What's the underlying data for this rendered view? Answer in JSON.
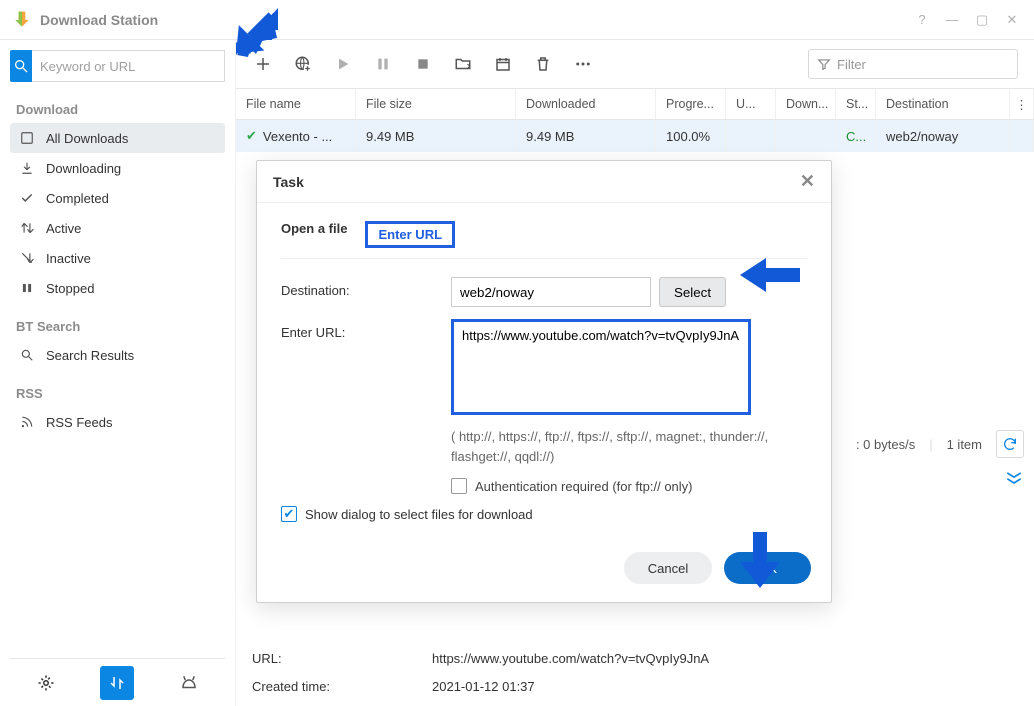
{
  "app": {
    "title": "Download Station"
  },
  "search": {
    "placeholder": "Keyword or URL"
  },
  "sidebar": {
    "section_download": "Download",
    "items": [
      {
        "label": "All Downloads"
      },
      {
        "label": "Downloading"
      },
      {
        "label": "Completed"
      },
      {
        "label": "Active"
      },
      {
        "label": "Inactive"
      },
      {
        "label": "Stopped"
      }
    ],
    "section_bt": "BT Search",
    "bt_items": [
      {
        "label": "Search Results"
      }
    ],
    "section_rss": "RSS",
    "rss_items": [
      {
        "label": "RSS Feeds"
      }
    ]
  },
  "filter": {
    "placeholder": "Filter"
  },
  "columns": {
    "name": "File name",
    "size": "File size",
    "downloaded": "Downloaded",
    "progress": "Progre...",
    "upload": "U...",
    "download": "Down...",
    "status": "St...",
    "destination": "Destination"
  },
  "rows": [
    {
      "name": "Vexento - ...",
      "size": "9.49 MB",
      "downloaded": "9.49 MB",
      "progress": "100.0%",
      "upload": "",
      "download": "",
      "status": "C...",
      "destination": "web2/noway"
    }
  ],
  "statusbar": {
    "speed": ": 0 bytes/s",
    "count": "1 item"
  },
  "details": {
    "url_label": "URL:",
    "url_value": "https://www.youtube.com/watch?v=tvQvpIy9JnA",
    "created_label": "Created time:",
    "created_value": "2021-01-12 01:37"
  },
  "modal": {
    "title": "Task",
    "tab_open": "Open a file",
    "tab_url": "Enter URL",
    "dest_label": "Destination:",
    "dest_value": "web2/noway",
    "select_label": "Select",
    "url_label": "Enter URL:",
    "url_value": "https://www.youtube.com/watch?v=tvQvpIy9JnA",
    "hint": "( http://, https://, ftp://, ftps://, sftp://, magnet:, thunder://, flashget://, qqdl://)",
    "auth_label": "Authentication required (for ftp:// only)",
    "show_dialog_label": "Show dialog to select files for download",
    "cancel": "Cancel",
    "ok": "OK"
  }
}
